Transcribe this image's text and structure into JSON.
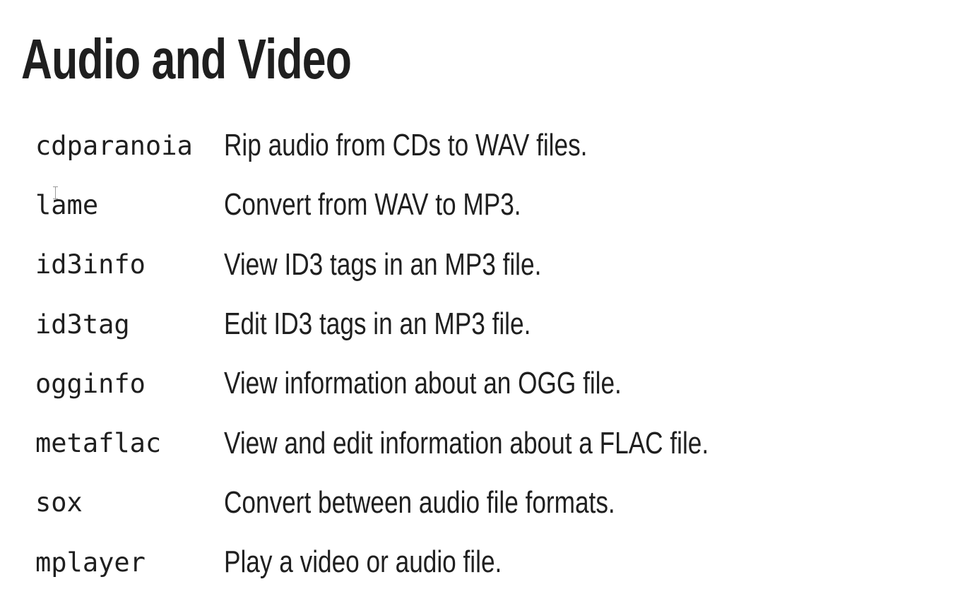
{
  "page": {
    "title": "Audio and Video"
  },
  "commands": [
    {
      "name": "cdparanoia",
      "description": "Rip audio from CDs to WAV files."
    },
    {
      "name": "lame",
      "description": "Convert from WAV to MP3."
    },
    {
      "name": "id3info",
      "description": "View ID3 tags in an MP3 file."
    },
    {
      "name": "id3tag",
      "description": "Edit ID3 tags in an MP3 file."
    },
    {
      "name": "ogginfo",
      "description": "View information about an OGG file."
    },
    {
      "name": "metaflac",
      "description": "View and edit information about a FLAC file."
    },
    {
      "name": "sox",
      "description": "Convert between audio file formats."
    },
    {
      "name": "mplayer",
      "description": "Play a video or audio file."
    }
  ],
  "cursor": {
    "icon": "text-cursor-icon"
  }
}
